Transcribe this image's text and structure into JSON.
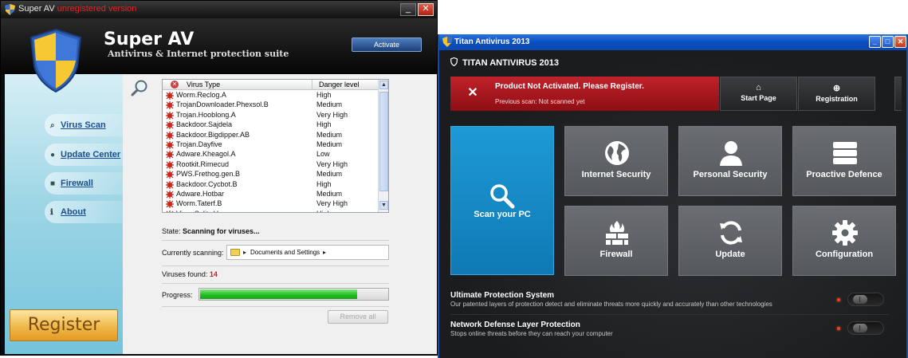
{
  "superav": {
    "window_title": "Super AV",
    "window_title_suffix": "unregistered version",
    "app_name": "Super AV",
    "tagline": "Antivirus & Internet protection suite",
    "activate_label": "Activate",
    "nav": [
      {
        "label": "Virus Scan",
        "icon": "magnifier-icon"
      },
      {
        "label": "Update Center",
        "icon": "globe-icon"
      },
      {
        "label": "Firewall",
        "icon": "briefcase-icon"
      },
      {
        "label": "About",
        "icon": "info-icon"
      }
    ],
    "register_label": "Register",
    "table": {
      "col_type": "Virus Type",
      "col_level": "Danger level",
      "rows": [
        {
          "name": "Worm.Reclog.A",
          "level": "High"
        },
        {
          "name": "TrojanDownloader.Phexsol.B",
          "level": "Medium"
        },
        {
          "name": "Trojan.Hooblong.A",
          "level": "Very High"
        },
        {
          "name": "Backdoor.Sajdela",
          "level": "High"
        },
        {
          "name": "Backdoor.Bigdipper.AB",
          "level": "Medium"
        },
        {
          "name": "Trojan.Dayfive",
          "level": "Medium"
        },
        {
          "name": "Adware.Kheagol.A",
          "level": "Low"
        },
        {
          "name": "Rootkit.Rimecud",
          "level": "Very High"
        },
        {
          "name": "PWS.Frethog.gen.B",
          "level": "Medium"
        },
        {
          "name": "Backdoor.Cycbot.B",
          "level": "High"
        },
        {
          "name": "Adware.Hotbar",
          "level": "Medium"
        },
        {
          "name": "Worm.Taterf.B",
          "level": "Very High"
        },
        {
          "name": "Virus.Sality.H",
          "level": "High"
        }
      ]
    },
    "state_label": "State:",
    "state_value": "Scanning for viruses...",
    "currently_scanning_label": "Currently scanning:",
    "currently_scanning_path": "Documents and Settings",
    "viruses_found_label": "Viruses found:",
    "viruses_found_count": "14",
    "progress_label": "Progress:",
    "progress_fraction": 0.84,
    "remove_all_label": "Remove all",
    "colors": {
      "accent": "#1b4e90",
      "progress": "#22c022",
      "unregistered": "#e22424"
    }
  },
  "titan": {
    "window_title": "Titan Antivirus 2013",
    "app_title": "TITAN ANTIVIRUS 2013",
    "alert_title": "Product Not Activated. Please Register.",
    "alert_sub": "Previous scan: Not scanned yet",
    "top_buttons": [
      {
        "label": "Start Page",
        "icon": "home-icon"
      },
      {
        "label": "Registration",
        "icon": "plus-circle-icon"
      }
    ],
    "scan_label": "Scan your PC",
    "tiles": [
      {
        "label": "Internet Security",
        "icon": "globe-icon"
      },
      {
        "label": "Personal Security",
        "icon": "user-icon"
      },
      {
        "label": "Proactive Defence",
        "icon": "server-icon"
      },
      {
        "label": "Firewall",
        "icon": "firewall-icon"
      },
      {
        "label": "Update",
        "icon": "refresh-icon"
      },
      {
        "label": "Configuration",
        "icon": "gear-icon"
      }
    ],
    "options": [
      {
        "title": "Ultimate Protection System",
        "desc": "Our patented layers of protection detect and eliminate threats more quickly and accurately than other technologies"
      },
      {
        "title": "Network Defense Layer Protection",
        "desc": "Stops online threats before they can reach your computer"
      }
    ],
    "colors": {
      "alert": "#c0222a",
      "scan_tile": "#1e9ad6",
      "tile": "#606367",
      "titlebar": "#0a4fc0"
    }
  }
}
